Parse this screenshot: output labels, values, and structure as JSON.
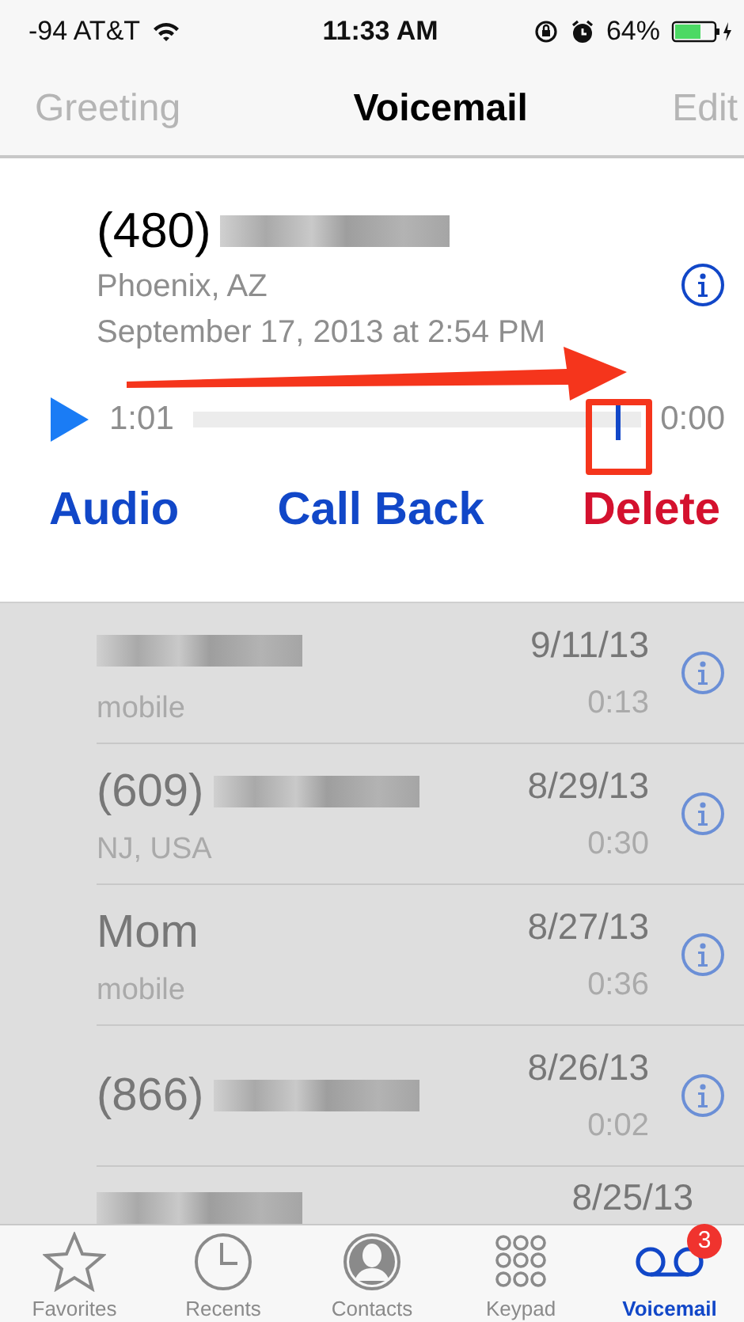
{
  "status_bar": {
    "carrier": "-94 AT&T",
    "time": "11:33 AM",
    "battery": "64%"
  },
  "nav_bar": {
    "left": "Greeting",
    "title": "Voicemail",
    "right": "Edit"
  },
  "detail": {
    "caller": "(480)",
    "redacted": true,
    "location": "Phoenix, AZ",
    "date": "September 17, 2013 at 2:54 PM",
    "elapsed": "1:01",
    "remaining": "0:00",
    "level": 0.95,
    "actions": [
      {
        "label": "Audio",
        "kind": "normal"
      },
      {
        "label": "Call Back",
        "kind": "normal"
      },
      {
        "label": "Delete",
        "kind": "destructive"
      }
    ]
  },
  "messages": [
    {
      "redacted": true,
      "subtitle": "mobile",
      "date": "9/11/13",
      "duration": "0:13"
    },
    {
      "name": "(609)",
      "redacted": true,
      "subtitle": "NJ, USA",
      "date": "8/29/13",
      "duration": "0:30"
    },
    {
      "name": "Mom",
      "redacted": false,
      "subtitle": "mobile",
      "date": "8/27/13",
      "duration": "0:36"
    },
    {
      "name": "(866)",
      "redacted": true,
      "date": "8/26/13",
      "duration": "0:02"
    },
    {
      "redacted": true,
      "date": "8/25/13"
    }
  ],
  "tab_bar": [
    {
      "label": "Favorites",
      "selected": false
    },
    {
      "label": "Recents",
      "selected": false
    },
    {
      "label": "Contacts",
      "selected": false
    },
    {
      "label": "Keypad",
      "selected": false
    },
    {
      "label": "Voicemail",
      "selected": true,
      "badge": "3"
    }
  ]
}
